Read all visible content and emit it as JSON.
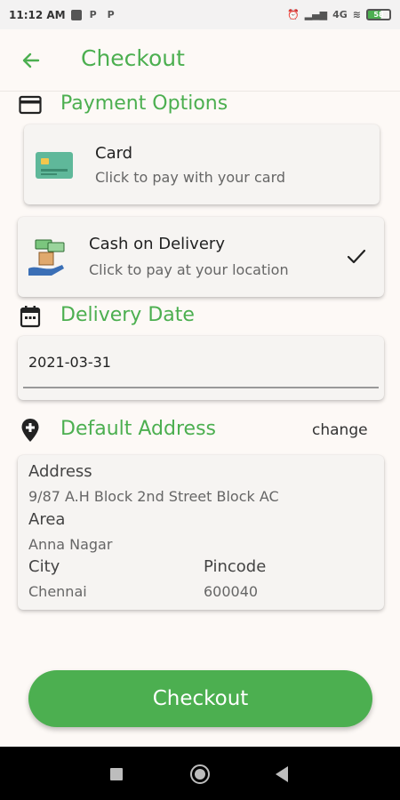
{
  "status_bar": {
    "time": "11:12 AM",
    "network": "4G",
    "battery": "58"
  },
  "header": {
    "title": "Checkout"
  },
  "payment": {
    "section_title": "Payment Options",
    "card": {
      "title": "Card",
      "subtitle": "Click to pay with your card"
    },
    "cod": {
      "title": "Cash on Delivery",
      "subtitle": "Click to pay at your location",
      "selected": true
    }
  },
  "delivery": {
    "section_title": "Delivery Date",
    "date_value": "2021-03-31"
  },
  "address": {
    "section_title": "Default Address",
    "change_label": "change",
    "address_label": "Address",
    "address_value": "9/87 A.H Block 2nd Street Block AC",
    "area_label": "Area",
    "area_value": "Anna Nagar",
    "city_label": "City",
    "city_value": "Chennai",
    "pincode_label": "Pincode",
    "pincode_value": "600040"
  },
  "checkout_button": {
    "label": "Checkout"
  },
  "colors": {
    "accent": "#4caf50",
    "background": "#fdf9f6",
    "card": "#f6f4f2"
  }
}
